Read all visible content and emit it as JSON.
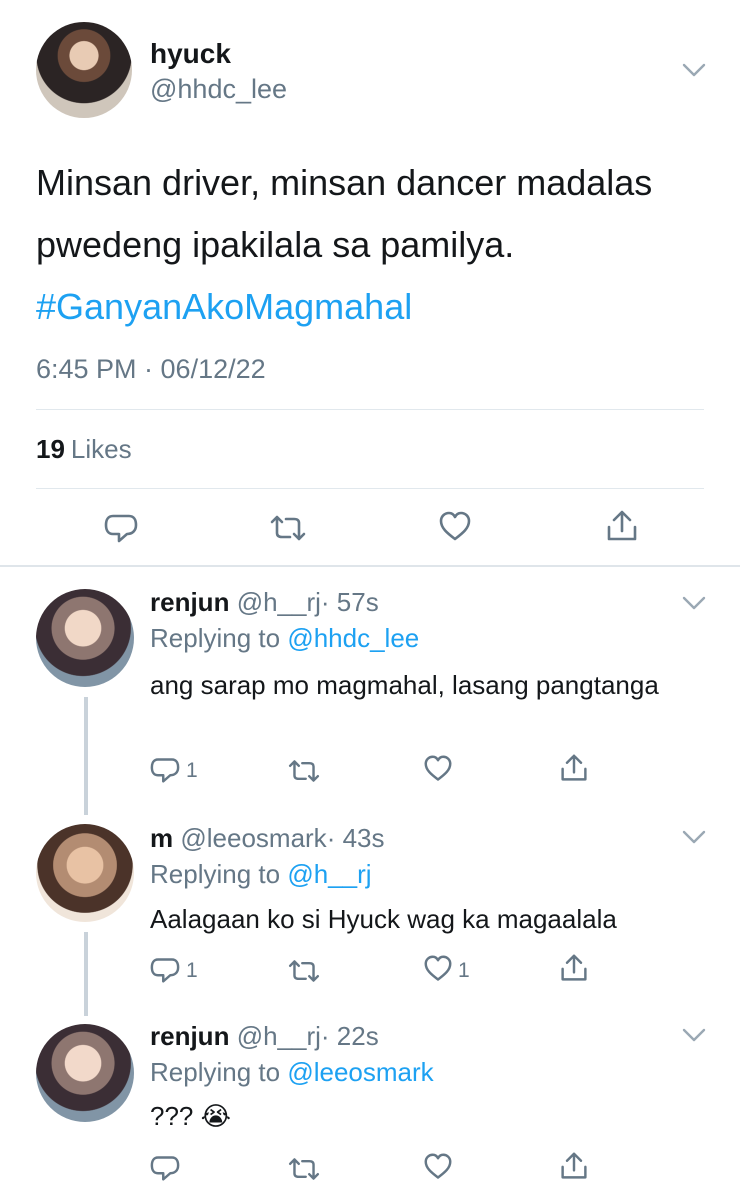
{
  "main_tweet": {
    "name": "hyuck",
    "handle": "@hhdc_lee",
    "text": "Minsan driver, minsan dancer madalas pwedeng ipakilala sa pamilya.",
    "hashtag": "#GanyanAkoMagmahal",
    "timestamp": "6:45 PM · 06/12/22",
    "likes_count": "19",
    "likes_label": "Likes"
  },
  "replies": [
    {
      "name": "renjun",
      "handle": "@h__rj",
      "time": "· 57s",
      "replying_prefix": "Replying to",
      "replying_to": "@hhdc_lee",
      "text": "ang sarap mo magmahal, lasang pangtanga",
      "reply_count": "1",
      "like_count": ""
    },
    {
      "name": "m",
      "handle": "@leeosmark",
      "time": "· 43s",
      "replying_prefix": "Replying to",
      "replying_to": "@h__rj",
      "text": "Aalagaan ko si Hyuck wag ka magaalala",
      "reply_count": "1",
      "like_count": "1"
    },
    {
      "name": "renjun",
      "handle": "@h__rj",
      "time": "· 22s",
      "replying_prefix": "Replying to",
      "replying_to": "@leeosmark",
      "text": "??? 😭",
      "reply_count": "",
      "like_count": ""
    }
  ],
  "colors": {
    "accent": "#1da1f2",
    "muted": "#657786",
    "text": "#14171a",
    "divider": "#e1e8ed"
  },
  "icons": [
    "reply-icon",
    "retweet-icon",
    "like-icon",
    "share-icon",
    "chevron-down-icon"
  ]
}
